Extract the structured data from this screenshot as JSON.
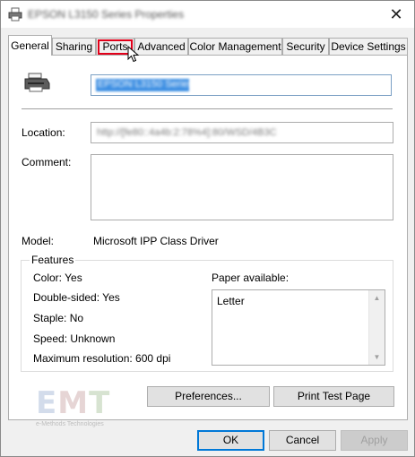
{
  "window": {
    "title": "EPSON L3150 Series Properties",
    "close_glyph": "✕"
  },
  "tabs": [
    {
      "label": "General"
    },
    {
      "label": "Sharing"
    },
    {
      "label": "Ports"
    },
    {
      "label": "Advanced"
    },
    {
      "label": "Color Management"
    },
    {
      "label": "Security"
    },
    {
      "label": "Device Settings"
    }
  ],
  "general": {
    "printer_name": "EPSON L3150 Series",
    "location_label": "Location:",
    "location_value": "http://[fe80::4a4b:2:78%4]:80/WSD/4B3C",
    "comment_label": "Comment:",
    "comment_value": "",
    "model_label": "Model:",
    "model_value": "Microsoft IPP Class Driver"
  },
  "features": {
    "title": "Features",
    "color": "Color: Yes",
    "double_sided": "Double-sided: Yes",
    "staple": "Staple: No",
    "speed": "Speed: Unknown",
    "max_resolution": "Maximum resolution: 600 dpi",
    "paper_label": "Paper available:",
    "paper_items": [
      "Letter"
    ]
  },
  "buttons": {
    "preferences": "Preferences...",
    "print_test": "Print Test Page",
    "ok": "OK",
    "cancel": "Cancel",
    "apply": "Apply"
  },
  "watermark": {
    "letters_e": "E",
    "letters_m": "M",
    "letters_t": "T",
    "subtitle": "e-Methods Technologies"
  },
  "icons": {
    "app": "printer-icon",
    "close": "close-icon",
    "cursor": "mouse-pointer-icon"
  },
  "colors": {
    "highlight_border": "#e2001a",
    "accent": "#0078d7",
    "selection": "#3d8fe3"
  }
}
